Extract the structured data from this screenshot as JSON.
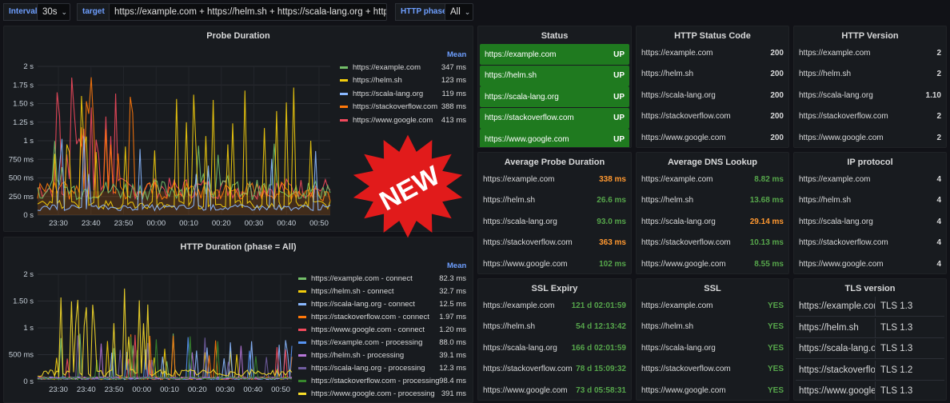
{
  "vars": {
    "interval_label": "Interval",
    "interval_value": "30s",
    "target_label": "target",
    "target_value": "https://example.com + https://helm.sh + https://scala-lang.org + https:/...",
    "phase_label": "HTTP phase",
    "phase_value": "All"
  },
  "badge": "NEW",
  "probe": {
    "title": "Probe Duration",
    "mean_label": "Mean",
    "yticks": [
      "2 s",
      "1.75 s",
      "1.50 s",
      "1.25 s",
      "1 s",
      "750 ms",
      "500 ms",
      "250 ms",
      "0 s"
    ],
    "xticks": [
      "23:30",
      "23:40",
      "23:50",
      "00:00",
      "00:10",
      "00:20",
      "00:30",
      "00:40",
      "00:50"
    ],
    "legend": [
      {
        "name": "https://example.com",
        "mean": "347 ms",
        "color": "#73bf69"
      },
      {
        "name": "https://helm.sh",
        "mean": "123 ms",
        "color": "#f2cc0c"
      },
      {
        "name": "https://scala-lang.org",
        "mean": "119 ms",
        "color": "#8ab8ff"
      },
      {
        "name": "https://stackoverflow.com",
        "mean": "388 ms",
        "color": "#ff780a"
      },
      {
        "name": "https://www.google.com",
        "mean": "413 ms",
        "color": "#f2495c"
      }
    ]
  },
  "http": {
    "title": "HTTP Duration (phase = All)",
    "mean_label": "Mean",
    "yticks": [
      "2 s",
      "1.50 s",
      "1 s",
      "500 ms",
      "0 s"
    ],
    "xticks": [
      "23:30",
      "23:40",
      "23:50",
      "00:00",
      "00:10",
      "00:20",
      "00:30",
      "00:40",
      "00:50"
    ],
    "legend": [
      {
        "name": "https://example.com - connect",
        "mean": "82.3 ms",
        "color": "#73bf69"
      },
      {
        "name": "https://helm.sh - connect",
        "mean": "32.7 ms",
        "color": "#f2cc0c"
      },
      {
        "name": "https://scala-lang.org - connect",
        "mean": "12.5 ms",
        "color": "#8ab8ff"
      },
      {
        "name": "https://stackoverflow.com - connect",
        "mean": "1.97 ms",
        "color": "#ff780a"
      },
      {
        "name": "https://www.google.com - connect",
        "mean": "1.20 ms",
        "color": "#f2495c"
      },
      {
        "name": "https://example.com - processing",
        "mean": "88.0 ms",
        "color": "#5794f2"
      },
      {
        "name": "https://helm.sh - processing",
        "mean": "39.1 ms",
        "color": "#b877d9"
      },
      {
        "name": "https://scala-lang.org - processing",
        "mean": "12.3 ms",
        "color": "#705da0"
      },
      {
        "name": "https://stackoverflow.com - processing",
        "mean": "98.4 ms",
        "color": "#37872d"
      },
      {
        "name": "https://www.google.com - processing",
        "mean": "391 ms",
        "color": "#fade2a"
      }
    ]
  },
  "status": {
    "title": "Status",
    "rows": [
      {
        "k": "https://example.com",
        "v": "UP"
      },
      {
        "k": "https://helm.sh",
        "v": "UP"
      },
      {
        "k": "https://scala-lang.org",
        "v": "UP"
      },
      {
        "k": "https://stackoverflow.com",
        "v": "UP"
      },
      {
        "k": "https://www.google.com",
        "v": "UP"
      }
    ]
  },
  "code": {
    "title": "HTTP Status Code",
    "rows": [
      {
        "k": "https://example.com",
        "v": "200"
      },
      {
        "k": "https://helm.sh",
        "v": "200"
      },
      {
        "k": "https://scala-lang.org",
        "v": "200"
      },
      {
        "k": "https://stackoverflow.com",
        "v": "200"
      },
      {
        "k": "https://www.google.com",
        "v": "200"
      }
    ]
  },
  "version": {
    "title": "HTTP Version",
    "rows": [
      {
        "k": "https://example.com",
        "v": "2"
      },
      {
        "k": "https://helm.sh",
        "v": "2"
      },
      {
        "k": "https://scala-lang.org",
        "v": "1.10"
      },
      {
        "k": "https://stackoverflow.com",
        "v": "2"
      },
      {
        "k": "https://www.google.com",
        "v": "2"
      }
    ]
  },
  "avgprobe": {
    "title": "Average Probe Duration",
    "rows": [
      {
        "k": "https://example.com",
        "v": "338 ms",
        "c": "orange"
      },
      {
        "k": "https://helm.sh",
        "v": "26.6 ms",
        "c": "green"
      },
      {
        "k": "https://scala-lang.org",
        "v": "93.0 ms",
        "c": "green"
      },
      {
        "k": "https://stackoverflow.com",
        "v": "363 ms",
        "c": "orange"
      },
      {
        "k": "https://www.google.com",
        "v": "102 ms",
        "c": "green"
      }
    ]
  },
  "avgdns": {
    "title": "Average DNS Lookup",
    "rows": [
      {
        "k": "https://example.com",
        "v": "8.82 ms",
        "c": "green"
      },
      {
        "k": "https://helm.sh",
        "v": "13.68 ms",
        "c": "green"
      },
      {
        "k": "https://scala-lang.org",
        "v": "29.14 ms",
        "c": "orange"
      },
      {
        "k": "https://stackoverflow.com",
        "v": "10.13 ms",
        "c": "green"
      },
      {
        "k": "https://www.google.com",
        "v": "8.55 ms",
        "c": "green"
      }
    ]
  },
  "ip": {
    "title": "IP protocol",
    "rows": [
      {
        "k": "https://example.com",
        "v": "4"
      },
      {
        "k": "https://helm.sh",
        "v": "4"
      },
      {
        "k": "https://scala-lang.org",
        "v": "4"
      },
      {
        "k": "https://stackoverflow.com",
        "v": "4"
      },
      {
        "k": "https://www.google.com",
        "v": "4"
      }
    ]
  },
  "sslexp": {
    "title": "SSL Expiry",
    "rows": [
      {
        "k": "https://example.com",
        "v": "121 d 02:01:59",
        "c": "green"
      },
      {
        "k": "https://helm.sh",
        "v": "54 d 12:13:42",
        "c": "green"
      },
      {
        "k": "https://scala-lang.org",
        "v": "166 d 02:01:59",
        "c": "green"
      },
      {
        "k": "https://stackoverflow.com",
        "v": "78 d 15:09:32",
        "c": "green"
      },
      {
        "k": "https://www.google.com",
        "v": "73 d 05:58:31",
        "c": "green"
      }
    ]
  },
  "ssl": {
    "title": "SSL",
    "rows": [
      {
        "k": "https://example.com",
        "v": "YES",
        "c": "green"
      },
      {
        "k": "https://helm.sh",
        "v": "YES",
        "c": "green"
      },
      {
        "k": "https://scala-lang.org",
        "v": "YES",
        "c": "green"
      },
      {
        "k": "https://stackoverflow.com",
        "v": "YES",
        "c": "green"
      },
      {
        "k": "https://www.google.com",
        "v": "YES",
        "c": "green"
      }
    ]
  },
  "tls": {
    "title": "TLS version",
    "rows": [
      {
        "k": "https://example.com",
        "v": "TLS 1.3"
      },
      {
        "k": "https://helm.sh",
        "v": "TLS 1.3"
      },
      {
        "k": "https://scala-lang.org",
        "v": "TLS 1.3"
      },
      {
        "k": "https://stackoverflo...",
        "v": "TLS 1.2"
      },
      {
        "k": "https://www.google...",
        "v": "TLS 1.3"
      }
    ]
  }
}
